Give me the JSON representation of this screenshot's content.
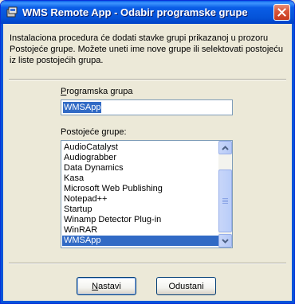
{
  "window": {
    "title": "WMS Remote App - Odabir programske grupe",
    "close_icon": "close-icon",
    "app_icon": "setup-icon"
  },
  "description": "Instalaciona procedura će dodati stavke grupi prikazanoj u prozoru\nPostojeće grupe. Možete uneti ime nove grupe ili selektovati postojeću\niz liste postojećih grupa.",
  "program_group": {
    "label_mnemonic": "P",
    "label_rest": "rogramska grupa",
    "value": "WMSApp"
  },
  "existing_groups": {
    "label": "Postojeće grupe:",
    "items": [
      "AudioCatalyst",
      "Audiograbber",
      "Data Dynamics",
      "Kasa",
      "Microsoft Web Publishing",
      "Notepad++",
      "Startup",
      "Winamp Detector Plug-in",
      "WinRAR",
      "WMSApp"
    ],
    "selected": "WMSApp"
  },
  "buttons": {
    "next_mnemonic": "N",
    "next_rest": "astavi",
    "cancel": "Odustani"
  },
  "colors": {
    "titlebar": "#0554d9",
    "selection": "#316ac5",
    "dialog_bg": "#ece9d8"
  }
}
